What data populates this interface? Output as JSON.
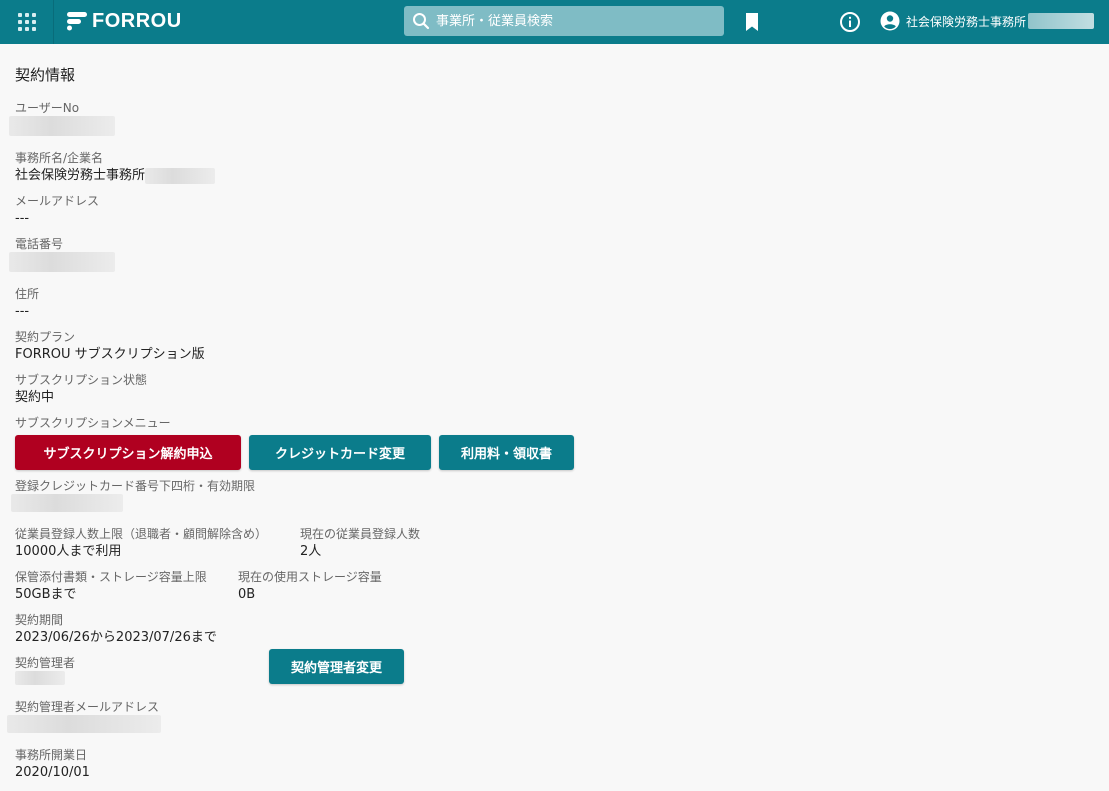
{
  "header": {
    "logo_text": "FORROU",
    "search_placeholder": "事業所・従業員検索",
    "account_name": "社会保険労務士事務所",
    "brand_color": "#0b7c8b",
    "icons": {
      "apps": "apps-grid-icon",
      "search": "search-icon",
      "bookmark": "bookmark-icon",
      "info": "info-icon",
      "account": "account-circle-icon"
    }
  },
  "page": {
    "title": "契約情報",
    "user_no": {
      "label": "ユーザーNo",
      "value": ""
    },
    "office_name": {
      "label": "事務所名/企業名",
      "value": "社会保険労務士事務所"
    },
    "email": {
      "label": "メールアドレス",
      "value": "---"
    },
    "phone": {
      "label": "電話番号",
      "value": ""
    },
    "address": {
      "label": "住所",
      "value": "---"
    },
    "plan": {
      "label": "契約プラン",
      "value": "FORROU サブスクリプション版"
    },
    "subscription_status": {
      "label": "サブスクリプション状態",
      "value": "契約中"
    },
    "subscription_menu": {
      "label": "サブスクリプションメニュー",
      "cancel_button": "サブスクリプション解約申込",
      "card_change_button": "クレジットカード変更",
      "fees_receipt_button": "利用料・領収書",
      "cancel_color": "#b00020"
    },
    "card_info": {
      "label": "登録クレジットカード番号下四桁・有効期限",
      "value": ""
    },
    "employee_limit": {
      "label": "従業員登録人数上限（退職者・顧問解除含め）",
      "value": "10000人まで利用"
    },
    "employee_count": {
      "label": "現在の従業員登録人数",
      "value": "2人"
    },
    "storage_limit": {
      "label": "保管添付書類・ストレージ容量上限",
      "value": "50GBまで"
    },
    "storage_used": {
      "label": "現在の使用ストレージ容量",
      "value": "0B"
    },
    "contract_period": {
      "label": "契約期間",
      "value": "2023/06/26から2023/07/26まで"
    },
    "contract_admin": {
      "label": "契約管理者",
      "value": "",
      "change_button": "契約管理者変更"
    },
    "admin_email": {
      "label": "契約管理者メールアドレス",
      "value": ""
    },
    "opening_date": {
      "label": "事務所開業日",
      "value": "2020/10/01"
    }
  }
}
